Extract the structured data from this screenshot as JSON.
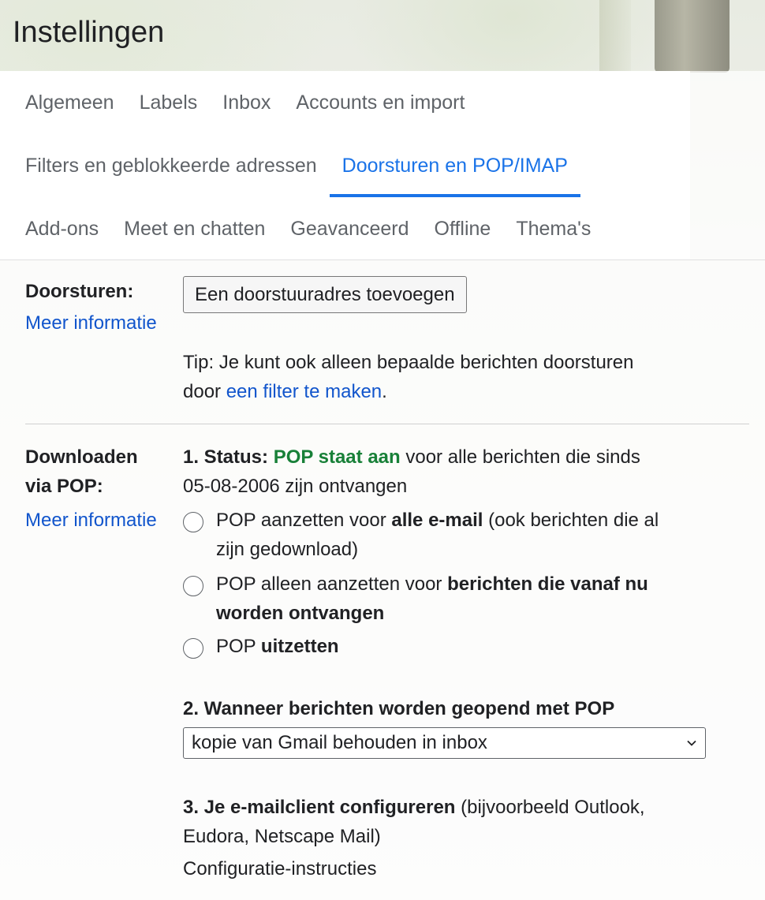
{
  "header": {
    "title": "Instellingen"
  },
  "tabs": {
    "row1": [
      "Algemeen",
      "Labels",
      "Inbox",
      "Accounts en import"
    ],
    "row2": [
      "Filters en geblokkeerde adressen",
      "Doorsturen en POP/IMAP"
    ],
    "row3": [
      "Add-ons",
      "Meet en chatten",
      "Geavanceerd",
      "Offline",
      "Thema's"
    ],
    "active": "Doorsturen en POP/IMAP"
  },
  "forwarding": {
    "label": "Doorsturen:",
    "more_info": "Meer informatie",
    "add_button": "Een doorstuuradres toevoegen",
    "tip_prefix": "Tip: Je kunt ook alleen bepaalde berichten doorsturen",
    "tip_door": "door ",
    "tip_link": "een filter te maken",
    "tip_suffix": "."
  },
  "pop": {
    "label_line1": "Downloaden",
    "label_line2": "via POP:",
    "more_info": "Meer informatie",
    "status_label": "1. Status: ",
    "status_value": "POP staat aan",
    "status_rest": " voor alle berichten die sinds",
    "status_line2": "05-08-2006 zijn ontvangen",
    "options": [
      {
        "prefix": "POP aanzetten voor ",
        "bold": "alle e-mail",
        "suffix": " (ook berichten die al",
        "line2": "zijn gedownload)",
        "line2_bold": false
      },
      {
        "prefix": "POP alleen aanzetten voor ",
        "bold": "berichten die vanaf nu",
        "suffix": "",
        "line2": "worden ontvangen",
        "line2_bold": true
      },
      {
        "prefix": "POP ",
        "bold": "uitzetten",
        "suffix": "",
        "line2": "",
        "line2_bold": false
      }
    ],
    "when_opened_label": "2. Wanneer berichten worden geopend met POP",
    "when_opened_value": "kopie van Gmail behouden in inbox",
    "configure_label": "3. Je e-mailclient configureren",
    "configure_rest": " (bijvoorbeeld Outlook,",
    "configure_line2": "Eudora, Netscape Mail)",
    "configure_link": "Configuratie-instructies"
  },
  "colors": {
    "accent": "#1a73e8",
    "link": "#1155cc",
    "status_green": "#188038"
  }
}
